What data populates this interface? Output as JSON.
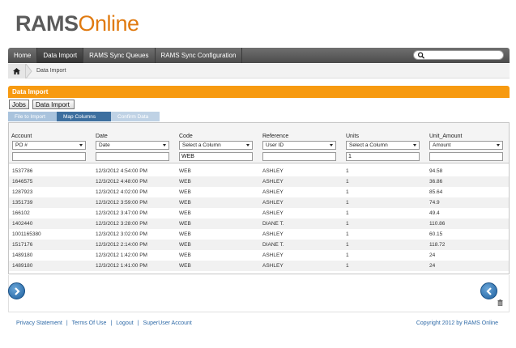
{
  "logo": {
    "part1": "RAMS",
    "part2": "Online"
  },
  "nav": {
    "items": [
      {
        "label": "Home"
      },
      {
        "label": "Data Import"
      },
      {
        "label": "RAMS Sync Queues"
      },
      {
        "label": "RAMS Sync Configuration"
      }
    ],
    "search_value": ""
  },
  "breadcrumb": {
    "current": "Data Import"
  },
  "panel": {
    "title": "Data Import"
  },
  "buttons": {
    "jobs": "Jobs",
    "data_import": "Data Import"
  },
  "steps": [
    "File to Import",
    "Map Columns",
    "Confirm Data"
  ],
  "columns": [
    {
      "title": "Account",
      "select": "PO #",
      "filter": ""
    },
    {
      "title": "Date",
      "select": "Date",
      "filter": ""
    },
    {
      "title": "Code",
      "select": "Select a Column",
      "filter": "WEB"
    },
    {
      "title": "Reference",
      "select": "User ID",
      "filter": ""
    },
    {
      "title": "Units",
      "select": "Select a Column",
      "filter": "1"
    },
    {
      "title": "Unit_Amount",
      "select": "Amount",
      "filter": ""
    }
  ],
  "rows": [
    [
      "1537786",
      "12/3/2012 4:54:00 PM",
      "WEB",
      "ASHLEY",
      "1",
      "94.58"
    ],
    [
      "1646575",
      "12/3/2012 4:48:00 PM",
      "WEB",
      "ASHLEY",
      "1",
      "36.86"
    ],
    [
      "1287923",
      "12/3/2012 4:02:00 PM",
      "WEB",
      "ASHLEY",
      "1",
      "85.64"
    ],
    [
      "1351739",
      "12/3/2012 3:59:00 PM",
      "WEB",
      "ASHLEY",
      "1",
      "74.9"
    ],
    [
      "166102",
      "12/3/2012 3:47:00 PM",
      "WEB",
      "ASHLEY",
      "1",
      "49.4"
    ],
    [
      "1402440",
      "12/3/2012 3:28:00 PM",
      "WEB",
      "DIANE T.",
      "1",
      "110.86"
    ],
    [
      "1001165380",
      "12/3/2012 3:02:00 PM",
      "WEB",
      "ASHLEY",
      "1",
      "60.15"
    ],
    [
      "1517176",
      "12/3/2012 2:14:00 PM",
      "WEB",
      "DIANE T.",
      "1",
      "118.72"
    ],
    [
      "1489180",
      "12/3/2012 1:42:00 PM",
      "WEB",
      "ASHLEY",
      "1",
      "24"
    ],
    [
      "1489180",
      "12/3/2012 1:41:00 PM",
      "WEB",
      "ASHLEY",
      "1",
      "24"
    ]
  ],
  "footer": {
    "links": [
      "Privacy Statement",
      "Terms Of Use",
      "Logout",
      "SuperUser Account"
    ],
    "separator": "|",
    "copyright": "Copyright 2012 by RAMS Online"
  },
  "colors": {
    "accent": "#f79a10",
    "nav": "#555555",
    "step_active": "#3d6f9f",
    "link": "#2f6aa7"
  },
  "icons": {
    "search": "magnifier-icon",
    "home": "home-icon",
    "next": "arrow-right-icon",
    "prev": "arrow-left-icon",
    "trash": "trash-icon"
  }
}
